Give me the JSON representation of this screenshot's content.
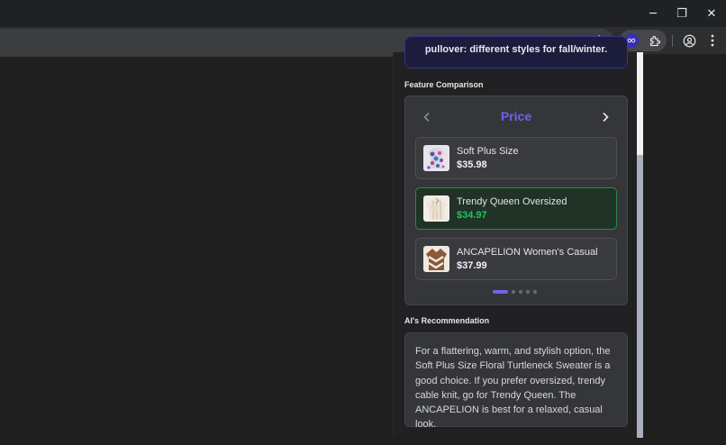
{
  "window": {
    "minimize_label": "─",
    "restore_label": "❐",
    "close_label": "✕"
  },
  "toolbar": {
    "bookmark_icon": "star-outline-icon",
    "extension_icon": "infinity-extension-icon",
    "extensions_icon": "puzzle-icon",
    "profile_icon": "account-circle-icon",
    "menu_icon": "kebab-menu-icon"
  },
  "panel": {
    "previous_card_text": "pullover: different styles for fall/winter.",
    "feature_comparison_title": "Feature Comparison",
    "comparison": {
      "heading": "Price",
      "prev_icon": "chevron-left-icon",
      "next_icon": "chevron-right-icon",
      "products": [
        {
          "name": "Soft Plus Size",
          "price": "$35.98",
          "highlight": false
        },
        {
          "name": "Trendy Queen Oversized",
          "price": "$34.97",
          "highlight": true
        },
        {
          "name": "ANCAPELION Women's Casual",
          "price": "$37.99",
          "highlight": false
        }
      ],
      "page_count": 5,
      "active_page": 1
    },
    "recommendation_title": "AI's Recommendation",
    "recommendation_text": "For a flattering, warm, and stylish option, the Soft Plus Size Floral Turtleneck Sweater is a good choice. If you prefer oversized, trendy cable knit, go for Trendy Queen. The ANCAPELION is best for a relaxed, casual look."
  },
  "colors": {
    "accent": "#6f63e8",
    "best_price": "#22c55e",
    "best_border": "#2a8a44"
  }
}
